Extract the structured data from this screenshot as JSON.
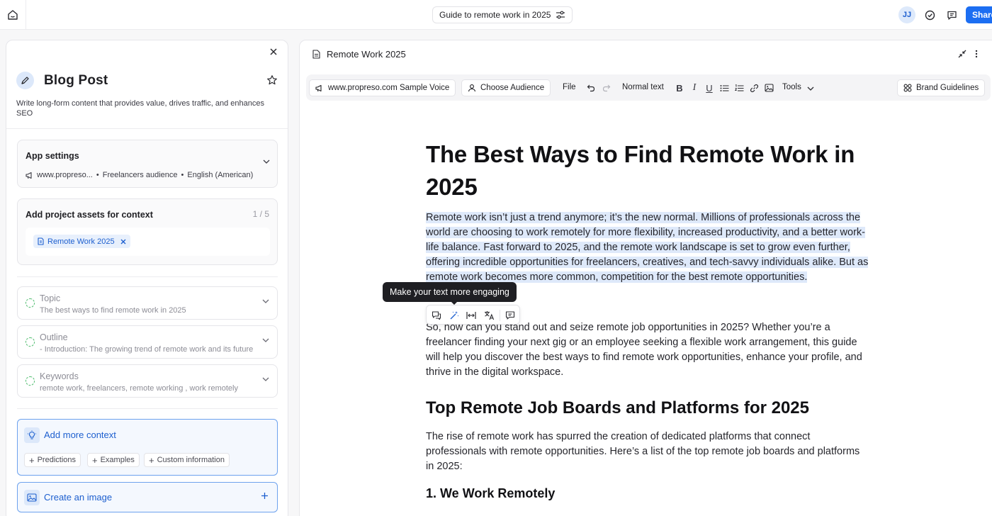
{
  "topbar": {
    "doc_title": "Guide to remote work in 2025",
    "avatar_initials": "JJ",
    "share_label": "Share"
  },
  "left_panel": {
    "title": "Blog Post",
    "description": "Write long-form content that provides value, drives traffic, and enhances SEO",
    "app_settings": {
      "title": "App settings",
      "voice": "www.propreso...",
      "audience": "Freelancers audience",
      "language": "English (American)",
      "separator": "•"
    },
    "assets": {
      "title": "Add project assets for context",
      "count": "1 / 5",
      "items": [
        {
          "label": "Remote Work 2025"
        }
      ]
    },
    "steps": [
      {
        "title": "Topic",
        "value": "The best ways to find remote work in 2025"
      },
      {
        "title": "Outline",
        "value": "- Introduction: The growing trend of remote work and its future"
      },
      {
        "title": "Keywords",
        "value": "remote work, freelancers, remote working , work remotely"
      }
    ],
    "add_context": {
      "title": "Add more context",
      "chips": [
        "Predictions",
        "Examples",
        "Custom information"
      ]
    },
    "create_image": {
      "title": "Create an image"
    }
  },
  "editor": {
    "doc_title": "Remote Work 2025",
    "toolbar": {
      "voice": "www.propreso.com Sample Voice",
      "audience": "Choose Audience",
      "file": "File",
      "text_style": "Normal text",
      "tools": "Tools",
      "brand": "Brand Guidelines",
      "bold": "B",
      "italic": "I",
      "underline": "U"
    },
    "document": {
      "h1": "The Best Ways to Find Remote Work in 2025",
      "p1": "Remote work isn’t just a trend anymore; it’s the new normal. Millions of professionals across the world are choosing to work remotely for more flexibility, increased productivity, and a better work-life balance. Fast forward to 2025, and the remote work landscape is set to grow even further, offering incredible opportunities for freelancers, creatives, and tech-savvy individuals alike. But as remote work becomes more common, competition for the best remote opportunities.",
      "p2": "So, how can you stand out and seize remote job opportunities in 2025? Whether you’re a freelancer finding your next gig or an employee seeking a flexible work arrangement, this guide will help you discover the best ways to find remote work opportunities, enhance your profile, and thrive in the digital workspace.",
      "h2": "Top Remote Job Boards and Platforms for 2025",
      "p3": "The rise of remote work has spurred the creation of dedicated platforms that connect professionals with remote opportunities. Here’s a list of the top remote job boards and platforms in 2025:",
      "h3": "1. We Work Remotely"
    },
    "tooltip": "Make your text more engaging"
  },
  "colors": {
    "accent": "#1c6ef2",
    "highlight": "#dee9fa",
    "step_dot": "#4cbb6b"
  }
}
